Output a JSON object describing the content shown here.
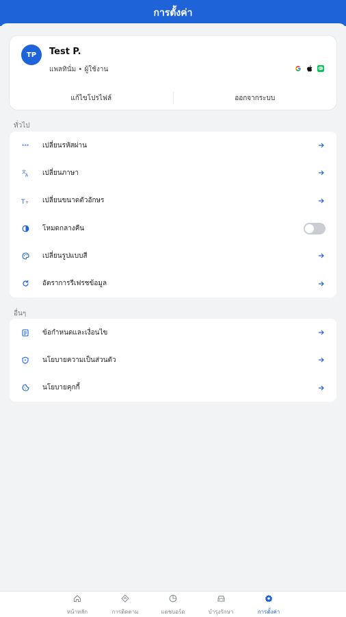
{
  "header": {
    "title": "การตั้งค่า"
  },
  "profile": {
    "initials": "TP",
    "name": "Test P.",
    "subtitle": "แพลทินั่ม • ผู้ใช้งาน",
    "providers": [
      "google-icon",
      "apple-icon",
      "line-icon"
    ],
    "actions": {
      "edit": "แก้ไขโปรไฟล์",
      "logout": "ออกจากระบบ"
    }
  },
  "general": {
    "label": "ทั่วไป",
    "items": [
      {
        "label": "เปลี่ยนรหัสผ่าน",
        "icon": "password-icon"
      },
      {
        "label": "เปลี่ยนภาษา",
        "icon": "language-icon"
      },
      {
        "label": "เปลี่ยนขนาดตัวอักษร",
        "icon": "font-size-icon"
      },
      {
        "label": "โหมดกลางคืน",
        "icon": "dark-mode-icon",
        "toggle": false
      },
      {
        "label": "เปลี่ยนรูปแบบสี",
        "icon": "palette-icon"
      },
      {
        "label": "อัตราการรีเฟรชข้อมูล",
        "icon": "refresh-icon"
      }
    ]
  },
  "other": {
    "label": "อื่นๆ",
    "items": [
      {
        "label": "ข้อกำหนดและเงื่อนไข",
        "icon": "terms-icon"
      },
      {
        "label": "นโยบายความเป็นส่วนตัว",
        "icon": "privacy-icon"
      },
      {
        "label": "นโยบายคุกกี้",
        "icon": "cookie-icon"
      }
    ]
  },
  "nav": {
    "items": [
      {
        "label": "หน้าหลัก",
        "icon": "home-icon",
        "active": false
      },
      {
        "label": "การติดตาม",
        "icon": "tracking-icon",
        "active": false
      },
      {
        "label": "แดชบอร์ด",
        "icon": "dashboard-icon",
        "active": false
      },
      {
        "label": "บำรุงรักษา",
        "icon": "car-icon",
        "active": false
      },
      {
        "label": "การตั้งค่า",
        "icon": "settings-icon",
        "active": true
      }
    ]
  },
  "colors": {
    "primary": "#1f63d8",
    "toggle_off": "#c9cdd3"
  }
}
